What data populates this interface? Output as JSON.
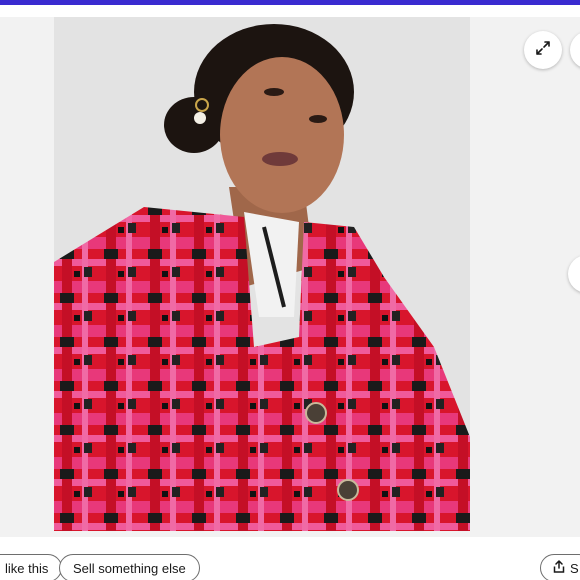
{
  "header": {
    "accent_color": "#3a2bd0"
  },
  "gallery": {
    "image_description_alt": "",
    "controls": {
      "expand_icon": "expand-arrows-icon",
      "next_icon": "chevron-right-icon"
    }
  },
  "actions": {
    "like_label": "like this",
    "sell_label": "Sell something else",
    "share_label": "S"
  }
}
